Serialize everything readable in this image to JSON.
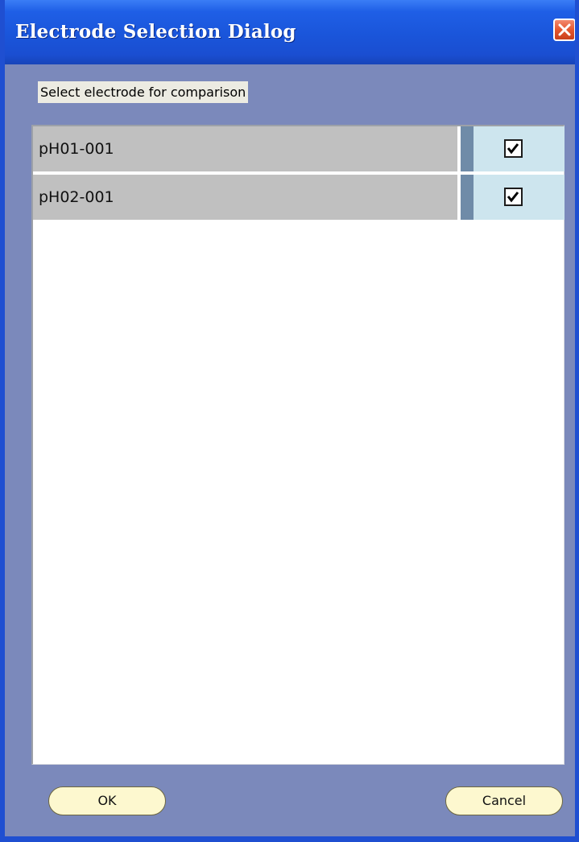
{
  "window": {
    "title": "Electrode Selection Dialog",
    "close_icon": "close-icon",
    "colors": {
      "titlebar": "#1f55da",
      "client_background": "#7b89bb",
      "close_button": "#e5572f",
      "row_name_background": "#c0c0c0",
      "row_divider": "#6f8ba8",
      "row_check_background": "#cde5ee",
      "button_background": "#fdf8cf"
    }
  },
  "prompt": {
    "label": "Select electrode for comparison"
  },
  "electrode_list": {
    "rows": [
      {
        "name": "pH01-001",
        "checked": true
      },
      {
        "name": "pH02-001",
        "checked": true
      }
    ]
  },
  "buttons": {
    "ok_label": "OK",
    "cancel_label": "Cancel"
  }
}
